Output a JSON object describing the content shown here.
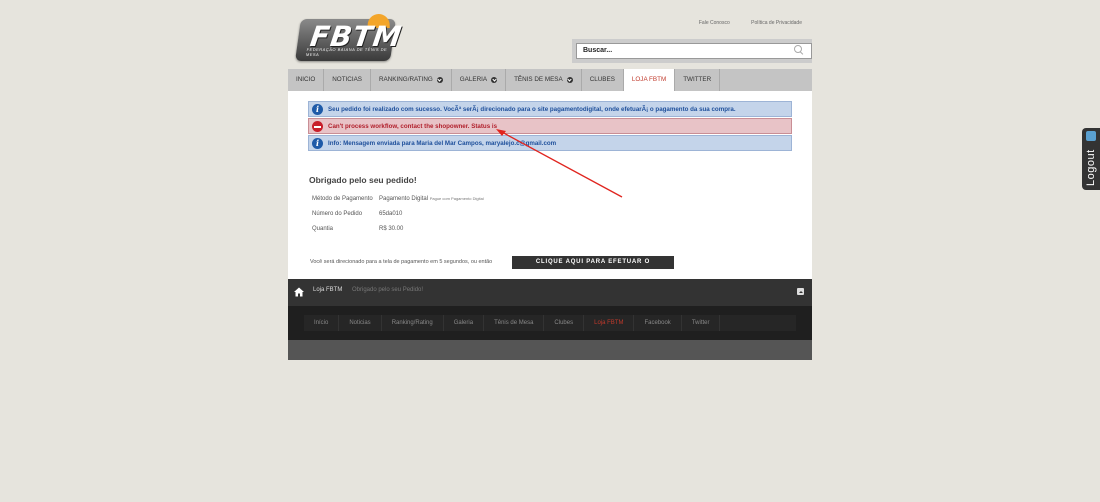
{
  "header": {
    "logo_text": "FBTM",
    "logo_sub": "FEDERAÇÃO BAIANA DE TÊNIS DE MESA",
    "links": [
      "Fale Conosco",
      "Política de Privacidade"
    ],
    "search_value": "Buscar..."
  },
  "nav": {
    "items": [
      {
        "label": "INICIO",
        "dropdown": false
      },
      {
        "label": "NOTICIAS",
        "dropdown": false
      },
      {
        "label": "RANKING/RATING",
        "dropdown": true
      },
      {
        "label": "GALERIA",
        "dropdown": true
      },
      {
        "label": "TÊNIS DE MESA",
        "dropdown": true
      },
      {
        "label": "CLUBES",
        "dropdown": false
      },
      {
        "label": "LOJA FBTM",
        "dropdown": false,
        "active": true
      },
      {
        "label": "TWITTER",
        "dropdown": false
      }
    ]
  },
  "messages": {
    "success": "Seu pedido foi realizado com sucesso. VocÃª serÃ¡ direcionado para o site pagamentodigital, onde efetuarÃ¡ o pagamento da sua compra.",
    "error": "Can't process workflow, contact the shopowner. Status is",
    "info": "Info: Mensagem enviada para Maria del Mar Campos, maryalejo.c@gmail.com"
  },
  "order": {
    "heading": "Obrigado pelo seu pedido!",
    "rows": [
      {
        "label": "Método de Pagamento",
        "value": "Pagamento Digital",
        "note": "Pague com Pagamento Digital"
      },
      {
        "label": "Número do Pedido",
        "value": "65da010",
        "note": ""
      },
      {
        "label": "Quantia",
        "value": "R$ 30.00",
        "note": ""
      }
    ],
    "redirect_text": "Você será direcionado para a tela de pagamento em 5 segundos, ou então",
    "pay_button": "CLIQUE AQUI PARA EFETUAR O PAGAMENTO"
  },
  "breadcrumb": {
    "section": "Loja FBTM",
    "current": "Obrigado pelo seu Pedido!"
  },
  "footer_nav": {
    "items": [
      {
        "label": "Início",
        "active": false
      },
      {
        "label": "Noticias",
        "active": false
      },
      {
        "label": "Ranking/Rating",
        "active": false
      },
      {
        "label": "Galeria",
        "active": false
      },
      {
        "label": "Tênis de Mesa",
        "active": false
      },
      {
        "label": "Clubes",
        "active": false
      },
      {
        "label": "Loja FBTM",
        "active": true
      },
      {
        "label": "Facebook",
        "active": false
      },
      {
        "label": "Twitter",
        "active": false
      }
    ]
  },
  "side": {
    "logout_label": "Logout"
  },
  "colors": {
    "accent": "#c0392b",
    "info_bg": "#c4d4ea",
    "error_bg": "#e8c3c7"
  }
}
